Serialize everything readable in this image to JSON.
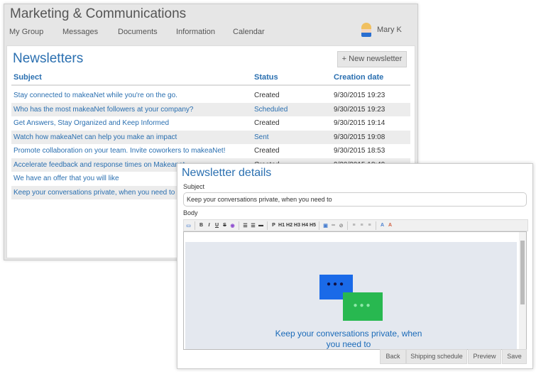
{
  "app": {
    "title": "Marketing & Communications",
    "nav": [
      "My Group",
      "Messages",
      "Documents",
      "Information",
      "Calendar"
    ],
    "user": "Mary K"
  },
  "newsletters": {
    "title": "Newsletters",
    "new_button": "+ New newsletter",
    "columns": [
      "Subject",
      "Status",
      "Creation date"
    ],
    "rows": [
      {
        "subject": "Stay connected to makeaNet while you're on the go.",
        "status": "Created",
        "date": "9/30/2015 19:23"
      },
      {
        "subject": "Who has the most makeaNet followers at your company?",
        "status": "Scheduled",
        "date": "9/30/2015 19:23"
      },
      {
        "subject": "Get Answers, Stay Organized and Keep Informed",
        "status": "Created",
        "date": "9/30/2015 19:14"
      },
      {
        "subject": "Watch how makeaNet can help you make an impact",
        "status": "Sent",
        "date": "9/30/2015 19:08"
      },
      {
        "subject": "Promote collaboration on your team. Invite coworkers to makeaNet!",
        "status": "Created",
        "date": "9/30/2015 18:53"
      },
      {
        "subject": "Accelerate feedback and response times on Makeanet.",
        "status": "Created",
        "date": "9/30/2015 18:49"
      },
      {
        "subject": "We have an offer that you will like",
        "status": "",
        "date": ""
      },
      {
        "subject": "Keep your conversations private, when you need to",
        "status": "",
        "date": ""
      }
    ]
  },
  "details": {
    "title": "Newsletter details",
    "subject_label": "Subject",
    "subject_value": "Keep your conversations private, when you need to",
    "body_label": "Body",
    "toolbar": [
      "B",
      "I",
      "U",
      "S",
      "P",
      "H1",
      "H2",
      "H3",
      "H4",
      "H5"
    ],
    "body_caption": "Keep your conversations private, when you need to",
    "buttons": [
      "Back",
      "Shipping schedule",
      "Preview",
      "Save"
    ]
  },
  "colors": {
    "accent": "#2a6fb0",
    "blue_bubble": "#1a6ae8",
    "green_bubble": "#28b850"
  }
}
